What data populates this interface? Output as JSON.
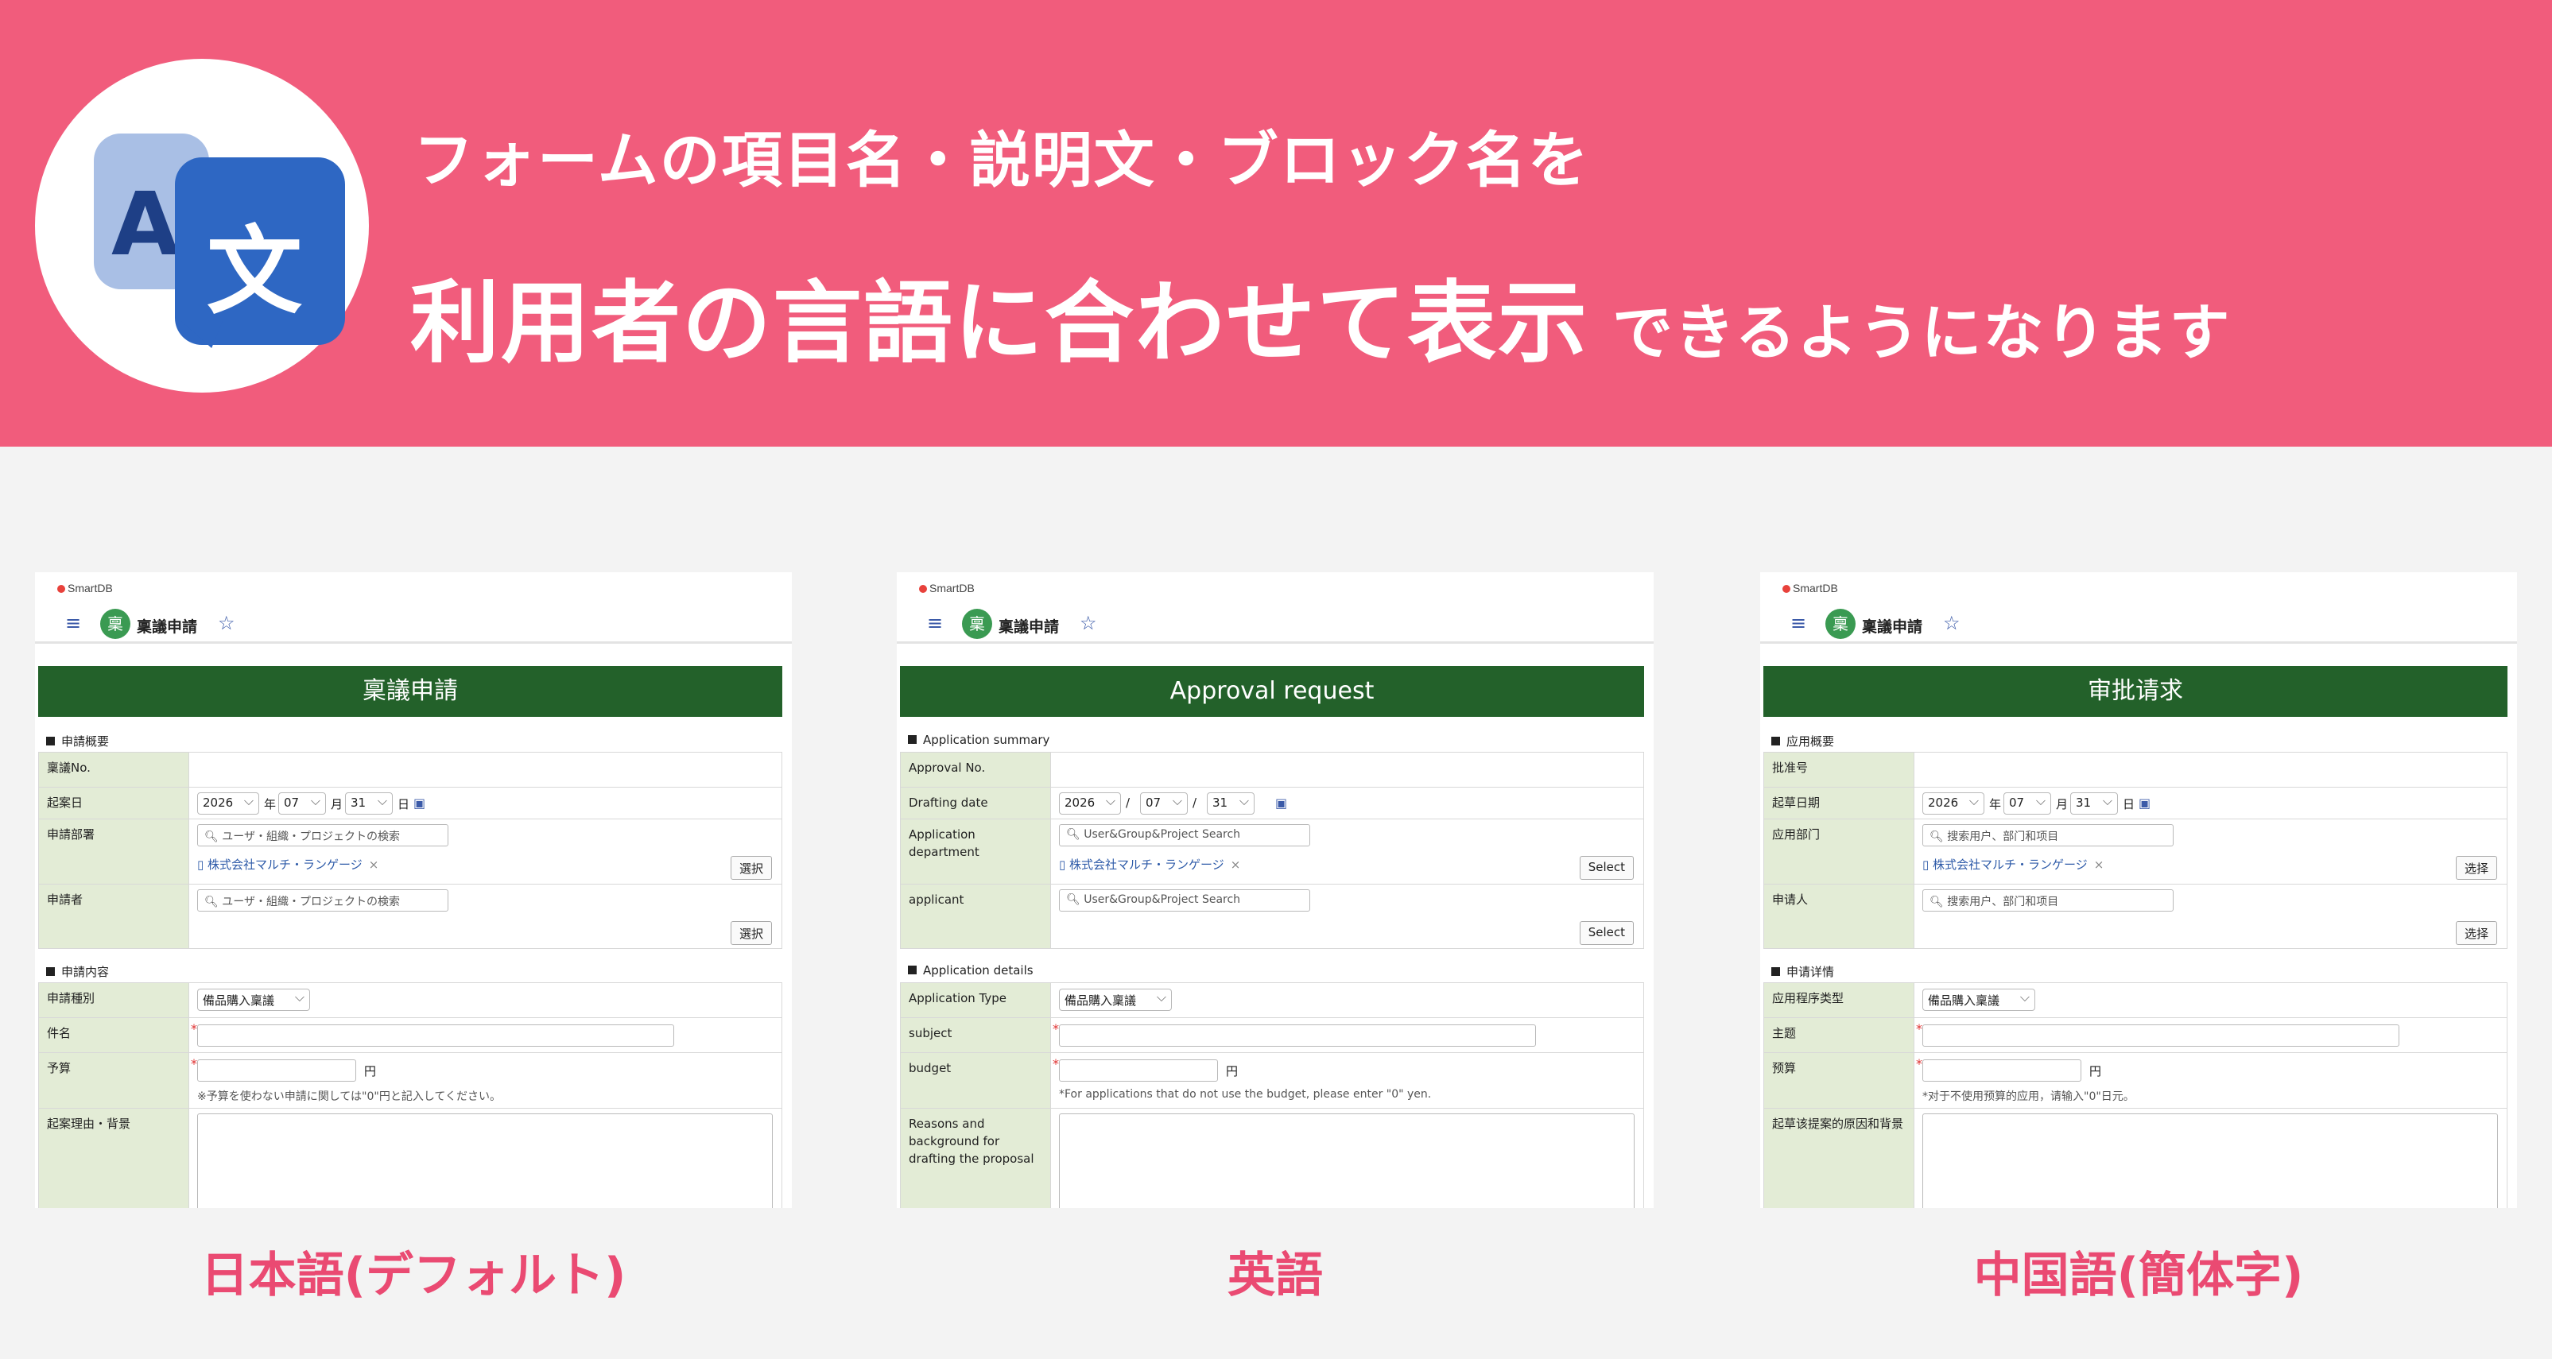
{
  "banner": {
    "line1": "フォームの項目名・説明文・ブロック名を",
    "line2_big": "利用者の言語に合わせて表示",
    "line2_small": "できるようになります",
    "icon_letter_a": "A",
    "icon_letter_kanji": "文"
  },
  "captions": [
    "日本語(デフォルト)",
    "英語",
    "中国語(簡体字)"
  ],
  "panels": [
    {
      "brand": "SmartDB",
      "app_badge": "稟",
      "app_name": "稟議申請",
      "title": "稟議申請",
      "section1": "申請概要",
      "labels": {
        "no": "稟議No.",
        "date": "起案日",
        "dept": "申請部署",
        "applicant": "申請者"
      },
      "year": "2026",
      "year_unit": "年",
      "month": "07",
      "month_unit": "月",
      "day": "31",
      "day_unit": "日",
      "search_placeholder": "ユーザ・組織・プロジェクトの検索",
      "chip": "株式会社マルチ・ランゲージ",
      "select_btn": "選択",
      "section2": "申請内容",
      "labels2": {
        "type": "申請種別",
        "subject": "件名",
        "budget": "予算",
        "reason": "起案理由・背景"
      },
      "type_value": "備品購入稟議",
      "budget_unit": "円",
      "budget_note": "※予算を使わない申請に関しては\"0\"円と記入してください。"
    },
    {
      "brand": "SmartDB",
      "app_badge": "稟",
      "app_name": "稟議申請",
      "title": "Approval request",
      "section1": "Application summary",
      "labels": {
        "no": "Approval No.",
        "date": "Drafting date",
        "dept": "Application department",
        "applicant": "applicant"
      },
      "year": "2026",
      "year_unit": "/",
      "month": "07",
      "month_unit": "/",
      "day": "31",
      "day_unit": "",
      "search_placeholder": "User&Group&Project Search",
      "chip": "株式会社マルチ・ランゲージ",
      "select_btn": "Select",
      "section2": "Application details",
      "labels2": {
        "type": "Application Type",
        "subject": "subject",
        "budget": "budget",
        "reason": "Reasons and background for drafting the proposal"
      },
      "type_value": "備品購入稟議",
      "budget_unit": "円",
      "budget_note": "*For applications that do not use the budget, please enter \"0\" yen."
    },
    {
      "brand": "SmartDB",
      "app_badge": "稟",
      "app_name": "稟議申請",
      "title": "审批请求",
      "section1": "应用概要",
      "labels": {
        "no": "批准号",
        "date": "起草日期",
        "dept": "应用部门",
        "applicant": "申请人"
      },
      "year": "2026",
      "year_unit": "年",
      "month": "07",
      "month_unit": "月",
      "day": "31",
      "day_unit": "日",
      "search_placeholder": "搜索用户、部门和项目",
      "chip": "株式会社マルチ・ランゲージ",
      "select_btn": "选择",
      "section2": "申请详情",
      "labels2": {
        "type": "应用程序类型",
        "subject": "主题",
        "budget": "预算",
        "reason": "起草该提案的原因和背景"
      },
      "type_value": "備品購入稟議",
      "budget_unit": "円",
      "budget_note": "*对于不使用预算的应用，请输入\"0\"日元。"
    }
  ]
}
